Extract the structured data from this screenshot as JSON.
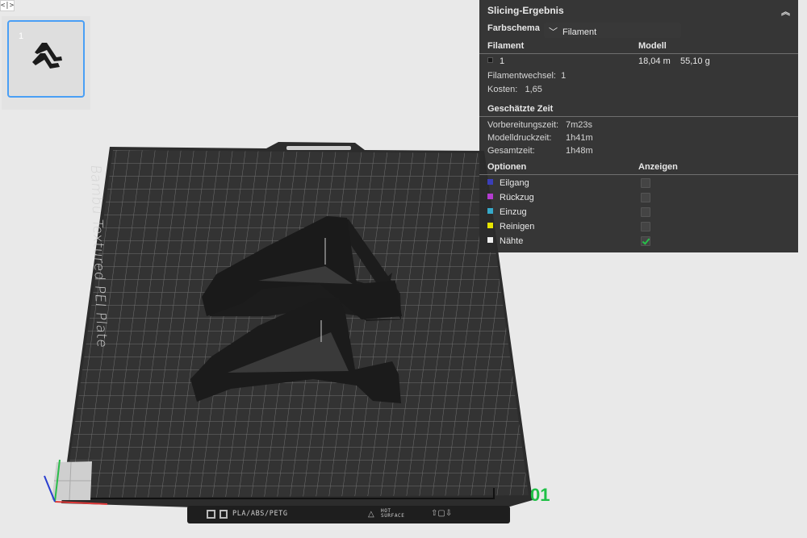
{
  "app": {
    "collapse_toggle": "<|>"
  },
  "plates": [
    {
      "number": "1"
    }
  ],
  "bed": {
    "plate_label": "Bambu Textured PEI Plate",
    "plate_id": "01",
    "bottom_bar": {
      "filament_types": "PLA/ABS/PETG",
      "surface_line1": "HOT",
      "surface_line2": "SURFACE"
    }
  },
  "panel": {
    "title": "Slicing-Ergebnis",
    "color_scheme_label": "Farbschema",
    "color_scheme_value": "Filament",
    "headers": {
      "filament": "Filament",
      "model": "Modell"
    },
    "filament_row": {
      "id": "1",
      "length": "18,04 m",
      "weight": "55,10 g",
      "color": "#1a1a1a"
    },
    "filament_changes_label": "Filamentwechsel:",
    "filament_changes_value": "1",
    "cost_label": "Kosten:",
    "cost_value": "1,65",
    "time_title": "Geschätzte Zeit",
    "times": [
      {
        "label": "Vorbereitungszeit:",
        "value": "7m23s"
      },
      {
        "label": "Modelldruckzeit:",
        "value": "1h41m"
      },
      {
        "label": "Gesamtzeit:",
        "value": "1h48m"
      }
    ],
    "options_header": "Optionen",
    "show_header": "Anzeigen",
    "options": [
      {
        "label": "Eilgang",
        "color": "#3b3fb8",
        "checked": false
      },
      {
        "label": "Rückzug",
        "color": "#b43cd0",
        "checked": false
      },
      {
        "label": "Einzug",
        "color": "#36a9c9",
        "checked": false
      },
      {
        "label": "Reinigen",
        "color": "#e7e500",
        "checked": false
      },
      {
        "label": "Nähte",
        "color": "#eeeeee",
        "checked": true
      }
    ]
  },
  "colors": {
    "accent_blue": "#4a9ff5",
    "plate_id_green": "#1fc046",
    "bed_dark": "#333333",
    "model": "#1c1c1c"
  }
}
